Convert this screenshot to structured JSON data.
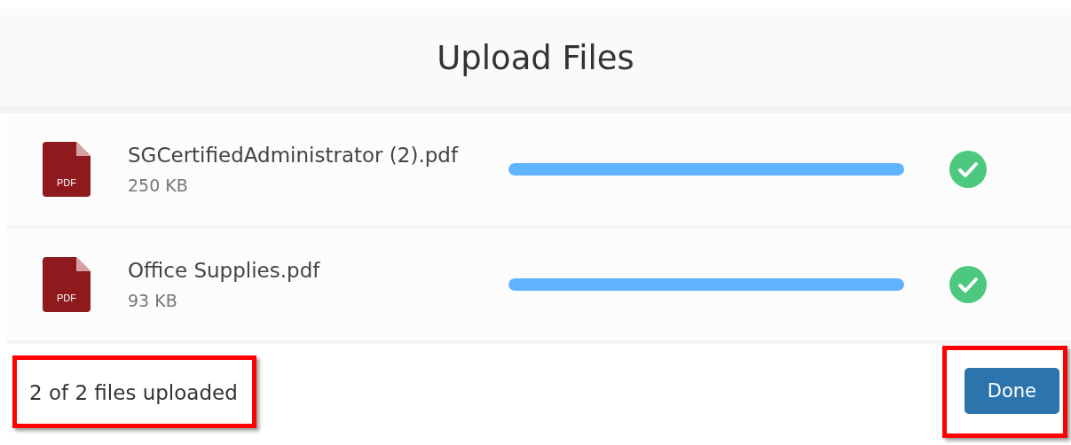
{
  "dialog": {
    "title": "Upload Files"
  },
  "files": [
    {
      "name": "SGCertifiedAdministrator (2).pdf",
      "size": "250 KB",
      "icon_label": "PDF",
      "level": 1,
      "complete": true
    },
    {
      "name": "Office Supplies.pdf",
      "size": "93 KB",
      "icon_label": "PDF",
      "level": 1,
      "complete": true
    }
  ],
  "footer": {
    "status": "2 of 2 files uploaded",
    "status_highlighted": true,
    "button": "Done",
    "button_highlighted": true
  }
}
